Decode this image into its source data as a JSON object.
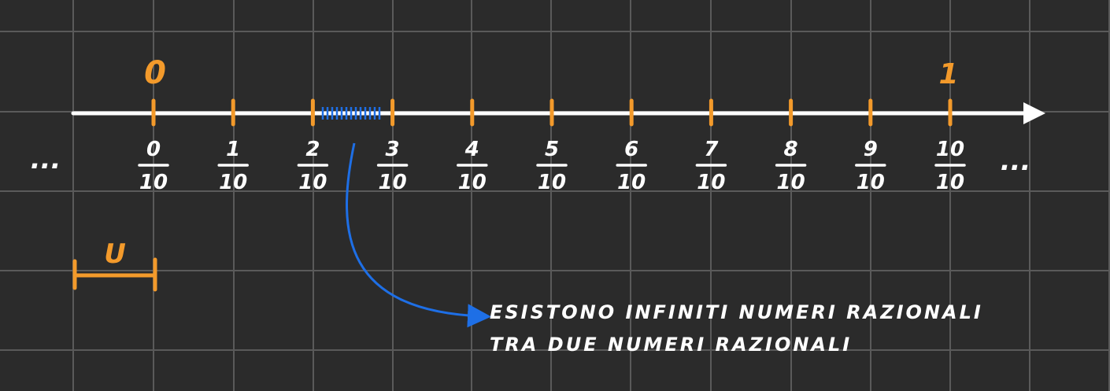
{
  "colors": {
    "background": "#2b2b2b",
    "grid": "#5a5a5a",
    "axis": "#ffffff",
    "accent": "#f39a2b",
    "annotation": "#1e6fe6",
    "text": "#ffffff"
  },
  "number_line": {
    "ellipsis_left": "...",
    "ellipsis_right": "...",
    "origin_label": "0",
    "one_label": "1",
    "ticks": [
      {
        "numerator": "0",
        "denominator": "10"
      },
      {
        "numerator": "1",
        "denominator": "10"
      },
      {
        "numerator": "2",
        "denominator": "10"
      },
      {
        "numerator": "3",
        "denominator": "10"
      },
      {
        "numerator": "4",
        "denominator": "10"
      },
      {
        "numerator": "5",
        "denominator": "10"
      },
      {
        "numerator": "6",
        "denominator": "10"
      },
      {
        "numerator": "7",
        "denominator": "10"
      },
      {
        "numerator": "8",
        "denominator": "10"
      },
      {
        "numerator": "9",
        "denominator": "10"
      },
      {
        "numerator": "10",
        "denominator": "10"
      }
    ]
  },
  "unit": {
    "label": "U"
  },
  "annotation": {
    "line1": "ESISTONO INFINITI NUMERI RAZIONALI",
    "line2": "TRA DUE NUMERI RAZIONALI"
  }
}
